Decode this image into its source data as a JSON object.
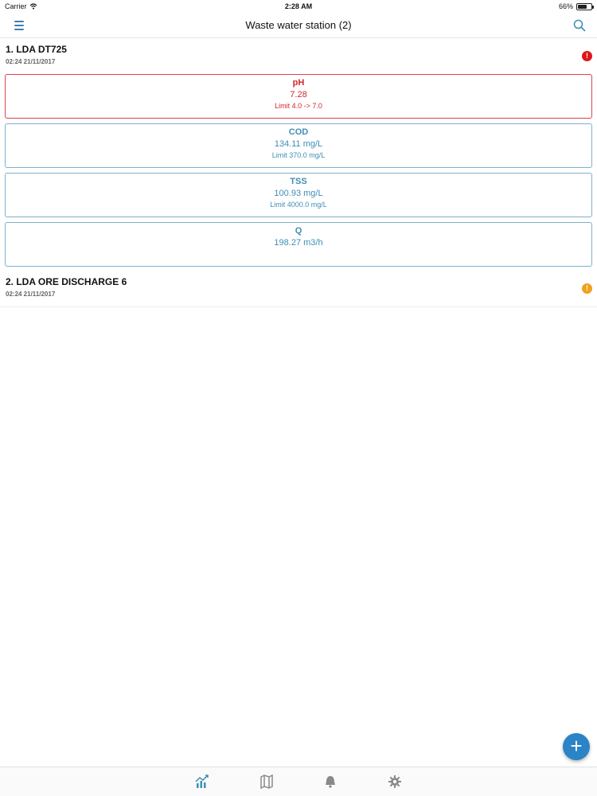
{
  "status_bar": {
    "carrier": "Carrier",
    "time": "2:28 AM",
    "battery": "66%",
    "battery_level": 0.66
  },
  "nav": {
    "title": "Waste water station (2)",
    "menu_icon": "hamburger-menu-icon",
    "search_icon": "search-icon"
  },
  "stations": [
    {
      "name": "1. LDA DT725",
      "time": "02:24 21/11/2017",
      "alert": "!",
      "alert_color": "#e0161c",
      "measures": [
        {
          "name": "pH",
          "value": "7.28",
          "limit": "Limit 4.0 -> 7.0",
          "status": "bad"
        },
        {
          "name": "COD",
          "value": "134.11 mg/L",
          "limit": "Limit 370.0 mg/L",
          "status": "ok"
        },
        {
          "name": "TSS",
          "value": "100.93 mg/L",
          "limit": "Limit 4000.0 mg/L",
          "status": "ok"
        },
        {
          "name": "Q",
          "value": "198.27 m3/h",
          "limit": "",
          "status": "ok"
        }
      ]
    },
    {
      "name": "2. LDA ORE DISCHARGE 6",
      "time": "02:24 21/11/2017",
      "alert": "!",
      "alert_color": "#f0a21b"
    }
  ],
  "fab": {
    "label": "+",
    "color": "#2a84c6"
  },
  "tabs": [
    {
      "icon": "chart-icon"
    },
    {
      "icon": "map-icon"
    },
    {
      "icon": "bell-icon"
    },
    {
      "icon": "gear-icon"
    }
  ],
  "colors": {
    "accent": "#3f8eb5",
    "alert_red": "#d0262d"
  }
}
